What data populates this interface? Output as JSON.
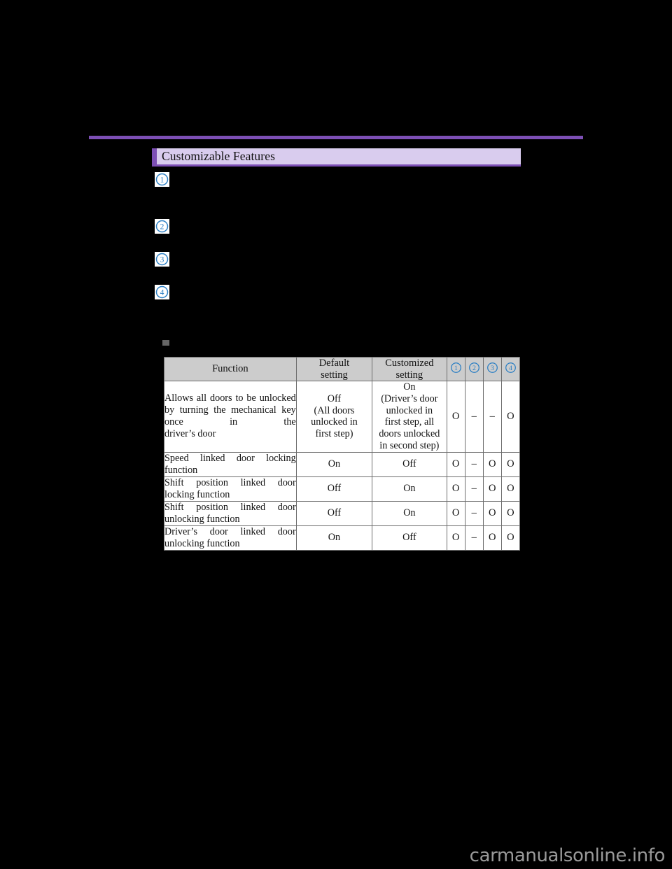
{
  "page": {
    "background_color": "#000000",
    "accent_purple": "#7d4fb5",
    "heading_bar_fill": "#d9ccee",
    "table_header_fill": "#cccccc",
    "marker_blue": "#2b7fc4"
  },
  "section": {
    "title": "Customizable Features"
  },
  "markers": [
    {
      "label": "1",
      "glyph": "①"
    },
    {
      "label": "2",
      "glyph": "②"
    },
    {
      "label": "3",
      "glyph": "③"
    },
    {
      "label": "4",
      "glyph": "④"
    }
  ],
  "table": {
    "headers": {
      "function": "Function",
      "default_setting_line1": "Default",
      "default_setting_line2": "setting",
      "customized_setting_line1": "Customized",
      "customized_setting_line2": "setting",
      "num1": "①",
      "num2": "②",
      "num3": "③",
      "num4": "④"
    },
    "rows": [
      {
        "function_main": "Allows all doors to be unlocked by turning the mechanical key once in the",
        "function_last": "driver’s door",
        "default_setting": "Off\n(All doors\nunlocked in\nfirst step)",
        "customized_setting": "On\n(Driver’s door\nunlocked in\nfirst step, all\ndoors unlocked\nin second step)",
        "marks": [
          "O",
          "–",
          "–",
          "O"
        ]
      },
      {
        "function_main": "Speed linked door locking",
        "function_last": "function",
        "default_setting": "On",
        "customized_setting": "Off",
        "marks": [
          "O",
          "–",
          "O",
          "O"
        ]
      },
      {
        "function_main": "Shift position linked door",
        "function_last": "locking function",
        "default_setting": "Off",
        "customized_setting": "On",
        "marks": [
          "O",
          "–",
          "O",
          "O"
        ]
      },
      {
        "function_main": "Shift position linked door",
        "function_last": "unlocking function",
        "default_setting": "Off",
        "customized_setting": "On",
        "marks": [
          "O",
          "–",
          "O",
          "O"
        ]
      },
      {
        "function_main": "Driver’s door linked door",
        "function_last": "unlocking function",
        "default_setting": "On",
        "customized_setting": "Off",
        "marks": [
          "O",
          "–",
          "O",
          "O"
        ]
      }
    ]
  },
  "watermark": {
    "text": "carmanualsonline.info"
  }
}
